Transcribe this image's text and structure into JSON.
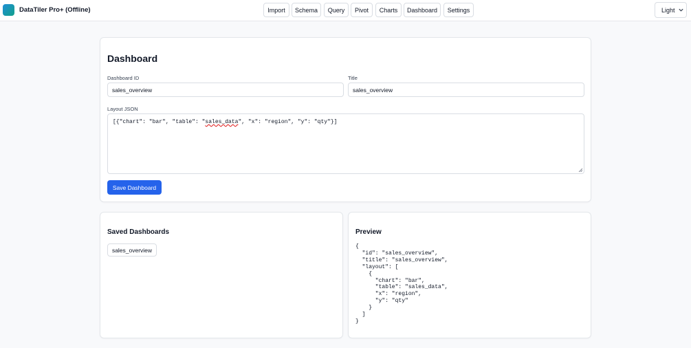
{
  "app": {
    "title": "DataTiler Pro+ (Offline)"
  },
  "nav": {
    "items": [
      {
        "label": "Import"
      },
      {
        "label": "Schema"
      },
      {
        "label": "Query"
      },
      {
        "label": "Pivot"
      },
      {
        "label": "Charts"
      },
      {
        "label": "Dashboard"
      },
      {
        "label": "Settings"
      }
    ]
  },
  "theme": {
    "selected": "Light",
    "options": [
      "Light"
    ]
  },
  "dashboard_form": {
    "heading": "Dashboard",
    "id_label": "Dashboard ID",
    "id_value": "sales_overview",
    "title_label": "Title",
    "title_value": "sales_overview",
    "layout_label": "Layout JSON",
    "layout_prefix": "[{\"chart\": \"bar\", \"table\": \"",
    "layout_misspelled": "sales_data",
    "layout_suffix": "\", \"x\": \"region\", \"y\": \"qty\"}]",
    "save_label": "Save Dashboard"
  },
  "saved": {
    "heading": "Saved Dashboards",
    "items": [
      {
        "label": "sales_overview"
      }
    ]
  },
  "preview": {
    "heading": "Preview",
    "json_text": "{\n  \"id\": \"sales_overview\",\n  \"title\": \"sales_overview\",\n  \"layout\": [\n    {\n      \"chart\": \"bar\",\n      \"table\": \"sales_data\",\n      \"x\": \"region\",\n      \"y\": \"qty\"\n    }\n  ]\n}"
  }
}
